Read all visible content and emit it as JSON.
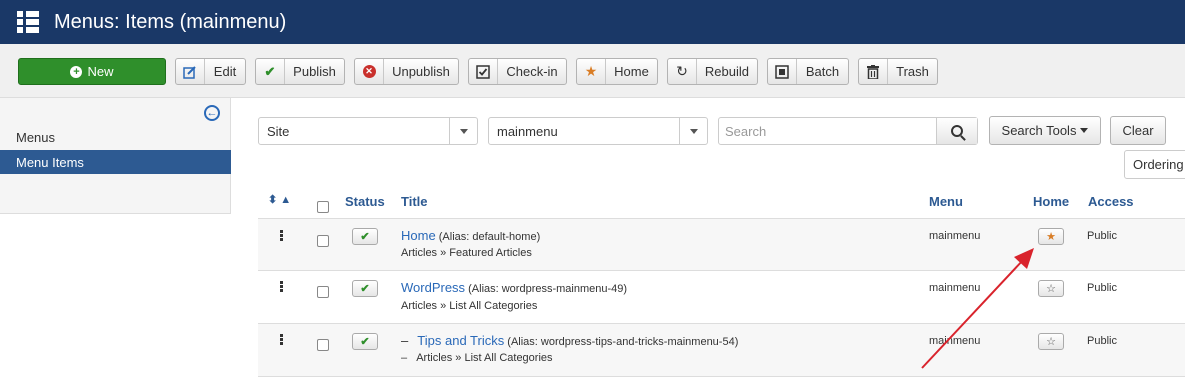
{
  "header": {
    "title": "Menus: Items (mainmenu)"
  },
  "toolbar": {
    "new_label": "New",
    "edit_label": "Edit",
    "publish_label": "Publish",
    "unpublish_label": "Unpublish",
    "checkin_label": "Check-in",
    "home_label": "Home",
    "rebuild_label": "Rebuild",
    "batch_label": "Batch",
    "trash_label": "Trash"
  },
  "sidebar": {
    "items": [
      {
        "label": "Menus"
      },
      {
        "label": "Menu Items"
      }
    ]
  },
  "filters": {
    "client": "Site",
    "menu": "mainmenu",
    "search_placeholder": "Search",
    "search_tools_label": "Search Tools",
    "clear_label": "Clear",
    "ordering_label": "Ordering"
  },
  "table": {
    "headers": {
      "status": "Status",
      "title": "Title",
      "menu": "Menu",
      "home": "Home",
      "access": "Access"
    },
    "rows": [
      {
        "prefix": "",
        "title": "Home",
        "alias": "(Alias: default-home)",
        "sub": "Articles » Featured Articles",
        "menu": "mainmenu",
        "access": "Public"
      },
      {
        "prefix": "",
        "title": "WordPress",
        "alias": "(Alias: wordpress-mainmenu-49)",
        "sub": "Articles » List All Categories",
        "menu": "mainmenu",
        "access": "Public"
      },
      {
        "prefix": "–",
        "title": "Tips and Tricks",
        "alias": "(Alias: wordpress-tips-and-tricks-mainmenu-54)",
        "sub": "Articles » List All Categories",
        "menu": "mainmenu",
        "access": "Public"
      }
    ]
  },
  "colors": {
    "header_bg": "#1a3867",
    "new_btn": "#2f8f2b",
    "active_side": "#2d5a92",
    "link": "#2a69b8",
    "arrow": "#d9232c"
  }
}
